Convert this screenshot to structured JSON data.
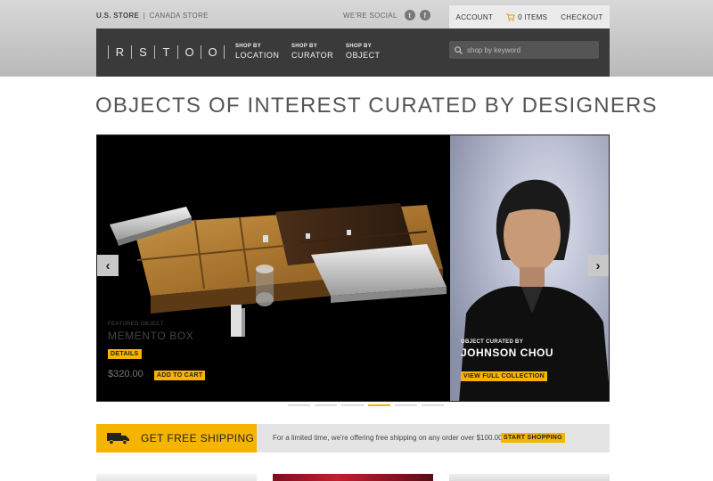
{
  "topbar": {
    "us_store": "U.S. STORE",
    "separator": "|",
    "canada_store": "CANADA STORE",
    "social_label": "WE'RE SOCIAL",
    "social_icons": [
      "twitter-icon",
      "facebook-icon"
    ],
    "twitter_glyph": "t",
    "facebook_glyph": "f",
    "account": "ACCOUNT",
    "cart": "0 ITEMS",
    "checkout": "CHECKOUT"
  },
  "nav": {
    "logo_letters": [
      "R",
      "S",
      "T",
      "O",
      "O"
    ],
    "links": [
      {
        "small": "SHOP BY",
        "big": "LOCATION"
      },
      {
        "small": "SHOP BY",
        "big": "CURATOR"
      },
      {
        "small": "SHOP BY",
        "big": "OBJECT"
      }
    ],
    "search_placeholder": "shop by keyword"
  },
  "headline": "OBJECTS OF INTEREST CURATED BY DESIGNERS",
  "hero": {
    "featured_label": "FEATURED OBJECT",
    "featured_title": "MEMENTO BOX",
    "details_btn": "DETAILS",
    "price": "$320.00",
    "add_to_cart_btn": "ADD TO CART",
    "curated_label": "OBJECT CURATED BY",
    "curator_name": "JOHNSON CHOU",
    "view_collection_btn": "VIEW FULL COLLECTION",
    "prev_glyph": "‹",
    "next_glyph": "›",
    "active_slide_index": 3,
    "slide_count": 6
  },
  "shipping": {
    "title": "GET FREE SHIPPING",
    "text": "For a limited time, we're offering free shipping on any order over $100.00.",
    "start_btn": "START SHOPPING"
  },
  "colors": {
    "accent": "#f5b400",
    "nav_bg": "#3a3a3a",
    "header_bg": "#c4c4c4"
  }
}
